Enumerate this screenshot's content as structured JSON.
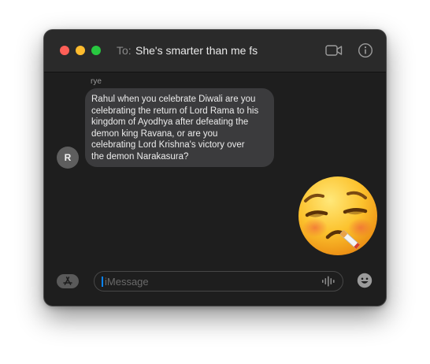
{
  "header": {
    "to_label": "To:",
    "recipient": "She's smarter than me fs",
    "icons": [
      "video-camera-icon",
      "info-icon"
    ]
  },
  "conversation": {
    "sender_name": "rye",
    "avatar_initial": "R",
    "message_text": "Rahul when you celebrate Diwali are you\ncelebrating the return of Lord Rama to his\nkingdom of Ayodhya after defeating the\ndemon king Ravana, or are you\ncelebrating Lord Krishna's victory over\nthe demon Narakasura?",
    "reply": {
      "type": "emoji",
      "icon": "tired-smoking-emoji"
    }
  },
  "composer": {
    "placeholder": "iMessage",
    "icons": [
      "app-store-icon",
      "audio-waveform-icon",
      "emoji-icon"
    ]
  },
  "colors": {
    "window_bg": "#1e1e1e",
    "titlebar_bg": "#2a2a2a",
    "incoming_bubble": "#3b3b3d",
    "accent": "#0a84ff",
    "close": "#ff5f57",
    "minimize": "#febc2e",
    "maximize": "#28c840"
  }
}
